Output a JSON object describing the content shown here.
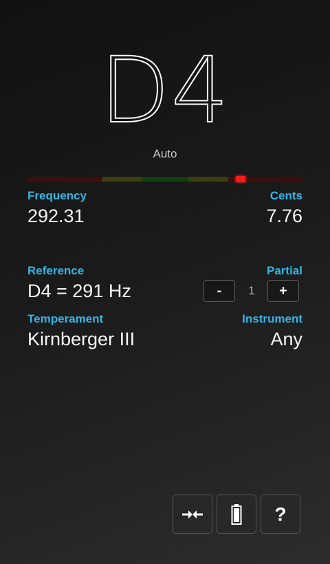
{
  "tuner": {
    "note": "D4",
    "mode": "Auto",
    "cents_level": 7.76
  },
  "meter": {
    "segment_colors": [
      "#3e0d0d",
      "#3d3d10",
      "#0f4010",
      "#3d3d10",
      "#3e0d0d"
    ],
    "needle_color": "#ff1a1a"
  },
  "readings": {
    "frequency_label": "Frequency",
    "frequency_value": "292.31",
    "cents_label": "Cents",
    "cents_value": "7.76"
  },
  "reference": {
    "label": "Reference",
    "value": "D4 = 291 Hz"
  },
  "partial": {
    "label": "Partial",
    "minus_label": "-",
    "value": "1",
    "plus_label": "+"
  },
  "temperament": {
    "label": "Temperament",
    "value": "Kirnberger III"
  },
  "instrument": {
    "label": "Instrument",
    "value": "Any"
  },
  "toolbar": {
    "buttons": [
      {
        "icon": "calibrate-arrows-icon"
      },
      {
        "icon": "battery-icon"
      },
      {
        "icon": "help-icon",
        "label": "?"
      }
    ]
  },
  "colors": {
    "accent": "#33b5e5",
    "text": "#f5f5f5"
  }
}
